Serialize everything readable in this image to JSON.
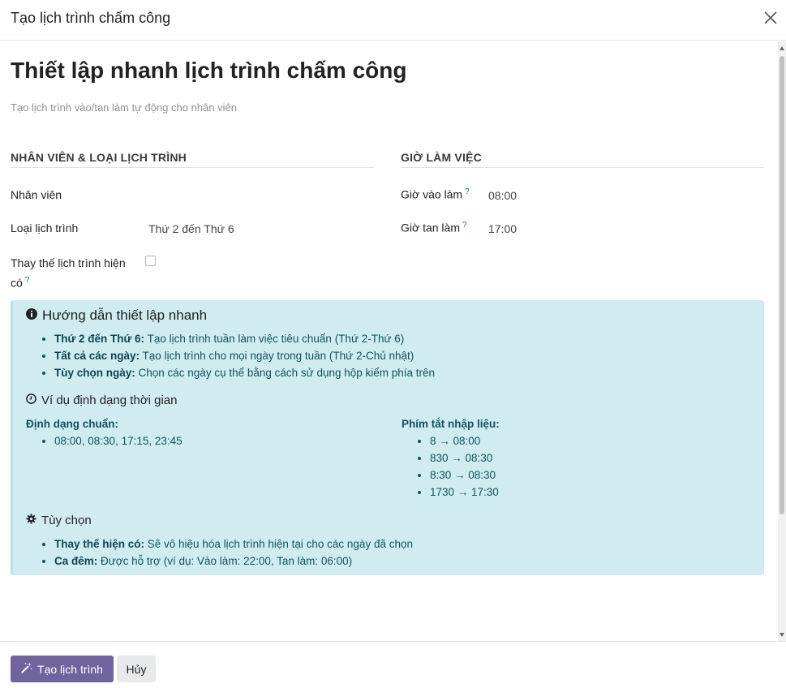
{
  "dialog": {
    "title": "Tạo lịch trình chấm công"
  },
  "main": {
    "heading": "Thiết lập nhanh lịch trình chấm công",
    "subtitle": "Tạo lịch trình vào/tan làm tự động cho nhân viên"
  },
  "left_section": {
    "title": "NHÂN VIÊN & LOẠI LỊCH TRÌNH",
    "employee_label": "Nhân viên",
    "employee_value": "",
    "schedule_type_label": "Loại lịch trình",
    "schedule_type_value": "Thứ 2 đến Thứ 6",
    "replace_label_line1": "Thay thế lịch trình hiện",
    "replace_label_line2": "có",
    "help_mark": "?",
    "replace_checked": false
  },
  "right_section": {
    "title": "GIỜ LÀM VIỆC",
    "checkin_label": "Giờ vào làm",
    "checkin_value": "08:00",
    "checkout_label": "Giờ tan làm",
    "checkout_value": "17:00"
  },
  "guide": {
    "title": "Hướng dẫn thiết lập nhanh",
    "items": [
      {
        "term": "Thứ 2 đến Thứ 6:",
        "desc": " Tạo lịch trình tuần làm việc tiêu chuẩn (Thứ 2-Thứ 6)"
      },
      {
        "term": "Tất cả các ngày:",
        "desc": " Tạo lịch trình cho mọi ngày trong tuần (Thứ 2-Chủ nhật)"
      },
      {
        "term": "Tùy chọn ngày:",
        "desc": " Chọn các ngày cụ thể bằng cách sử dụng hộp kiểm phía trên"
      }
    ],
    "time_title": "Ví dụ định dạng thời gian",
    "standard_title": "Định dạng chuẩn:",
    "standard_items": [
      "08:00, 08:30, 17:15, 23:45"
    ],
    "shortcut_title": "Phím tắt nhập liệu:",
    "shortcut_items": [
      "8 → 08:00",
      "830 → 08:30",
      "8:30 → 08:30",
      "1730 → 17:30"
    ],
    "options_title": "Tùy chọn",
    "options_items": [
      {
        "term": "Thay thế hiện có:",
        "desc": " Sẽ vô hiệu hóa lịch trình hiện tại cho các ngày đã chọn"
      },
      {
        "term": "Ca đêm:",
        "desc": " Được hỗ trợ (ví dụ: Vào làm: 22:00, Tan làm: 06:00)"
      }
    ]
  },
  "footer": {
    "create_label": "Tạo lịch trình",
    "cancel_label": "Hủy"
  },
  "colors": {
    "primary": "#71639e",
    "info_bg": "#d1ecf1",
    "info_text": "#0c5460"
  }
}
